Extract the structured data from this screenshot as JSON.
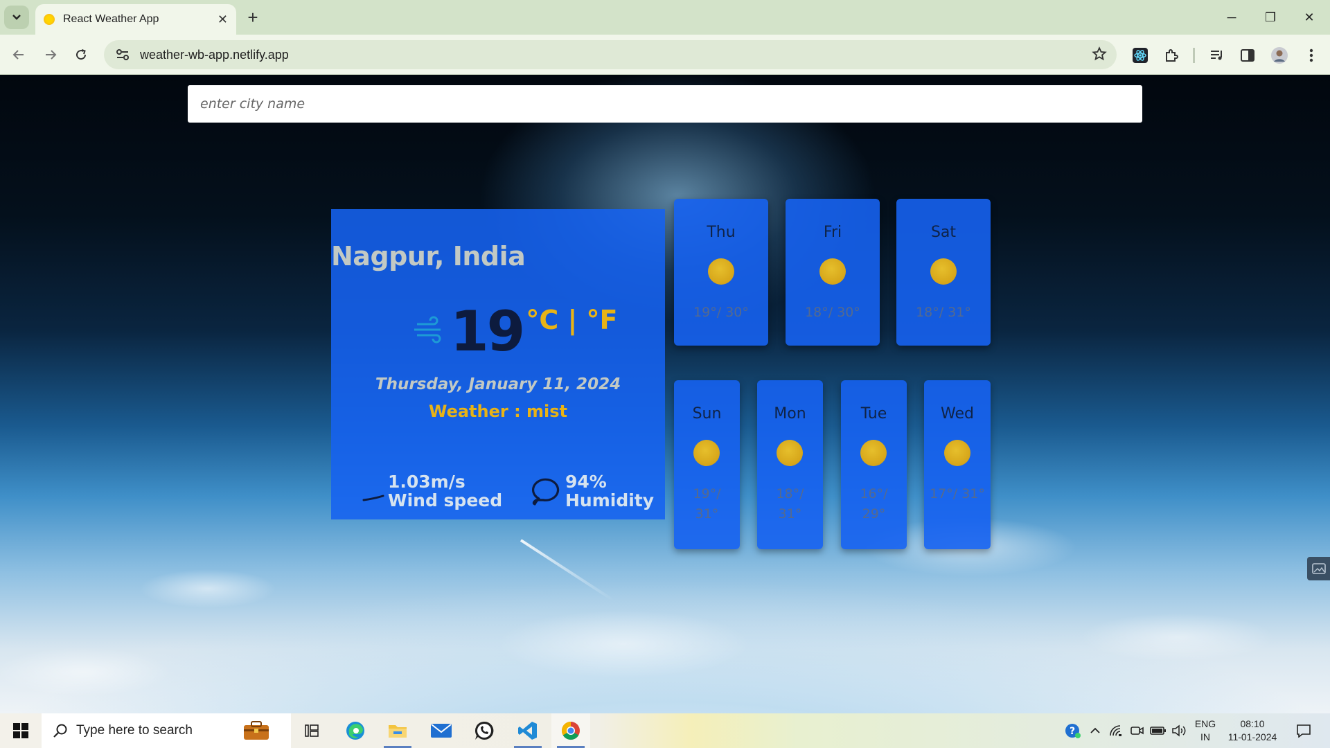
{
  "browser": {
    "tab_title": "React Weather App",
    "tab_close": "✕",
    "new_tab": "+",
    "url": "weather-wb-app.netlify.app",
    "window_controls": [
      "─",
      "❐",
      "✕"
    ]
  },
  "search": {
    "placeholder": "enter city name"
  },
  "current": {
    "city": "Nagpur, India",
    "temperature": "19",
    "units": "°C | °F",
    "date": "Thursday, January 11, 2024",
    "condition": "Weather : mist",
    "wind_value": "1.03m/s",
    "wind_label": "Wind speed",
    "humidity_value": "94%",
    "humidity_label": "Humidity"
  },
  "forecast": [
    {
      "day": "Thu",
      "range": "19°/ 30°"
    },
    {
      "day": "Fri",
      "range": "18°/ 30°"
    },
    {
      "day": "Sat",
      "range": "18°/ 31°"
    },
    {
      "day": "Sun",
      "range": "19°/ 31°"
    },
    {
      "day": "Mon",
      "range": "18°/ 31°"
    },
    {
      "day": "Tue",
      "range": "16°/ 29°"
    },
    {
      "day": "Wed",
      "range": "17°/ 31°"
    }
  ],
  "colors": {
    "card_blue": "#1662f0",
    "accent_yellow": "#e8b316",
    "temp_dark": "#0d1b3e"
  },
  "taskbar": {
    "search_text": "Type here to search",
    "lang_line1": "ENG",
    "lang_line2": "IN",
    "time": "08:10",
    "date": "11-01-2024"
  }
}
